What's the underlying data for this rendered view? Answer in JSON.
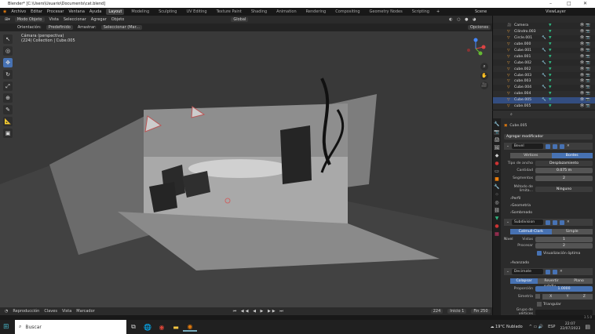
{
  "window": {
    "title": "Blender* [C:\\Users\\Usuario\\Documents\\cat.blend]"
  },
  "menu": {
    "items": [
      "Archivo",
      "Editar",
      "Procesar",
      "Ventana",
      "Ayuda"
    ],
    "workspaces": [
      "Layout",
      "Modeling",
      "Sculpting",
      "UV Editing",
      "Texture Paint",
      "Shading",
      "Animation",
      "Rendering",
      "Compositing",
      "Geometry Nodes",
      "Scripting"
    ],
    "scene": "Scene",
    "view_layer": "ViewLayer"
  },
  "header": {
    "mode": "Modo Objeto",
    "items": [
      "Vista",
      "Seleccionar",
      "Agregar",
      "Objeto"
    ],
    "transform": "Global",
    "options": "Opciones"
  },
  "toolheader": {
    "orientation_label": "Orientación:",
    "orientation": "Predefinido",
    "drag_label": "Arrastrar:",
    "drag": "Seleccionar (Mar..."
  },
  "viewport": {
    "view": "Cámara (perspectiva)",
    "collection": "(224) Collection | Cube.005"
  },
  "outliner": {
    "items": [
      {
        "name": "Camera",
        "type": "camera"
      },
      {
        "name": "Cilindro.003",
        "type": "mesh"
      },
      {
        "name": "Circle.001",
        "type": "mesh",
        "mod": true
      },
      {
        "name": "cube.000",
        "type": "mesh"
      },
      {
        "name": "Cube.001",
        "type": "mesh",
        "mod": true
      },
      {
        "name": "cube.001",
        "type": "mesh"
      },
      {
        "name": "Cube.002",
        "type": "mesh",
        "mod": true
      },
      {
        "name": "cube.002",
        "type": "mesh"
      },
      {
        "name": "Cube.003",
        "type": "mesh",
        "mod": true
      },
      {
        "name": "cube.003",
        "type": "mesh"
      },
      {
        "name": "Cube.004",
        "type": "mesh",
        "mod": true
      },
      {
        "name": "cube.004",
        "type": "mesh"
      },
      {
        "name": "Cube.005",
        "type": "mesh",
        "mod": true,
        "selected": true
      },
      {
        "name": "cube.005",
        "type": "mesh"
      }
    ]
  },
  "properties": {
    "object": "Cube.005",
    "add_modifier": "Agregar modificador",
    "bevel": {
      "name": "Bevel",
      "tabs": [
        "Vértices",
        "Bordes"
      ],
      "width_type_label": "Tipo de ancho",
      "width_type": "Desplazamiento",
      "amount_label": "Cantidad",
      "amount": "0.075 m",
      "segments_label": "Segmentos",
      "segments": "2",
      "limit_label": "Método de limita...",
      "limit": "Ninguno",
      "panels": [
        "Perfil",
        "Geometría",
        "Sombreado"
      ]
    },
    "subdivision": {
      "name": "Subdivision",
      "tabs": [
        "Catmull-Clark",
        "Simple"
      ],
      "level_label": "Nivel",
      "viewport_label": "Vistas",
      "viewport": "1",
      "render_label": "Procesar",
      "render": "2",
      "optimal": "Visualización óptima",
      "advanced": "Avanzado"
    },
    "decimate": {
      "name": "Decimate",
      "tabs": [
        "Colapsar",
        "Revertir subdiv...",
        "Plano"
      ],
      "ratio_label": "Proporción",
      "ratio": "1.0000",
      "symmetry_label": "Simetría",
      "axes": [
        "X",
        "Y",
        "Z"
      ],
      "triangulate": "Triangular",
      "vgroup_label": "Grupo de vértices"
    }
  },
  "timeline": {
    "items": [
      "Reproducción",
      "Claves",
      "Vista",
      "Marcador"
    ],
    "frame": "224",
    "start_label": "Inicio",
    "start": "1",
    "end_label": "Fin",
    "end": "250"
  },
  "status": {
    "version": "3.5.0"
  },
  "taskbar": {
    "search": "Buscar",
    "weather": "19°C Nublado",
    "lang": "ESP",
    "time": "22:07",
    "date": "22/07/2023"
  }
}
